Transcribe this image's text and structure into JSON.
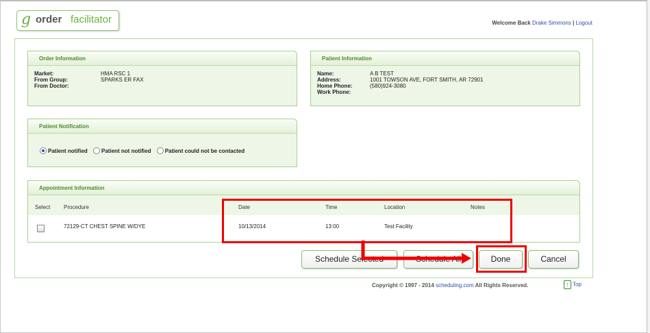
{
  "logo": {
    "glyph": "g",
    "word1": "order",
    "word2": "facilitator"
  },
  "header": {
    "welcome": "Welcome Back",
    "user": "Drake Simmons",
    "separator": " | ",
    "logout": "Logout"
  },
  "order_info": {
    "title": "Order Information",
    "rows": [
      {
        "label": "Market:",
        "value": "HMA RSC 1"
      },
      {
        "label": "From Group:",
        "value": "SPARKS ER FAX"
      },
      {
        "label": "From Doctor:",
        "value": ""
      }
    ]
  },
  "patient_info": {
    "title": "Patient Information",
    "rows": [
      {
        "label": "Name:",
        "value": "A B TEST"
      },
      {
        "label": "Address:",
        "value": "1001 TOWSON AVE, FORT SMITH, AR 72901"
      },
      {
        "label": "Home Phone:",
        "value": "(580)924-3080"
      },
      {
        "label": "Work Phone:",
        "value": ""
      }
    ]
  },
  "notification": {
    "title": "Patient Notification",
    "options": [
      "Patient notified",
      "Patient not notified",
      "Patient could not be contacted"
    ],
    "selected": "Patient notified"
  },
  "appointment": {
    "title": "Appointment Information",
    "columns": [
      "Select",
      "Procedure",
      "Date",
      "Time",
      "Location",
      "Notes"
    ],
    "rows": [
      {
        "procedure": "72129-CT CHEST SPINE W/DYE",
        "date": "10/13/2014",
        "time": "13:00",
        "location": "Test Facility",
        "notes": ""
      }
    ]
  },
  "buttons": {
    "schedule_selected": "Schedule Selected",
    "schedule_all": "Schedule All",
    "done": "Done",
    "cancel": "Cancel"
  },
  "footer": {
    "copyright": "Copyright © 1997 - 2014",
    "link": "scheduling.com",
    "rights": "All Rights Reserved.",
    "top": "Top"
  },
  "colors": {
    "accent_green": "#6cae3a",
    "annotation_red": "#e00000",
    "link_blue": "#2a4fa5"
  }
}
